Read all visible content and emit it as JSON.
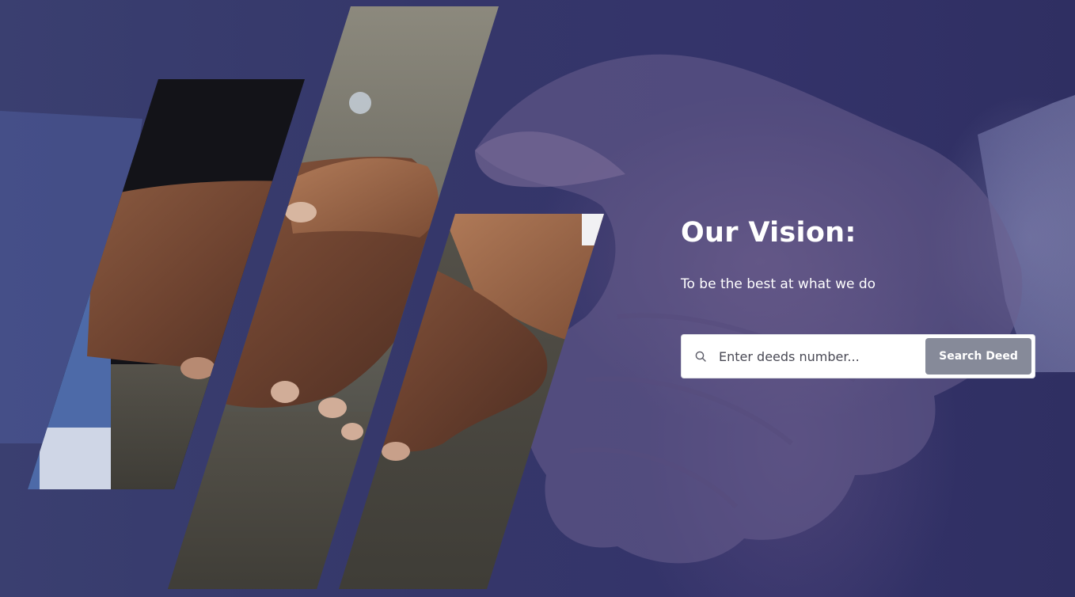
{
  "hero": {
    "title": "Our Vision:",
    "subtitle": "To be the best at what we do",
    "overlay_color": "#34346a",
    "image_subject": "handshake"
  },
  "search": {
    "placeholder": "Enter deeds number...",
    "icon": "search-icon",
    "button_label": "Search Deed",
    "button_color": "#868a99"
  }
}
